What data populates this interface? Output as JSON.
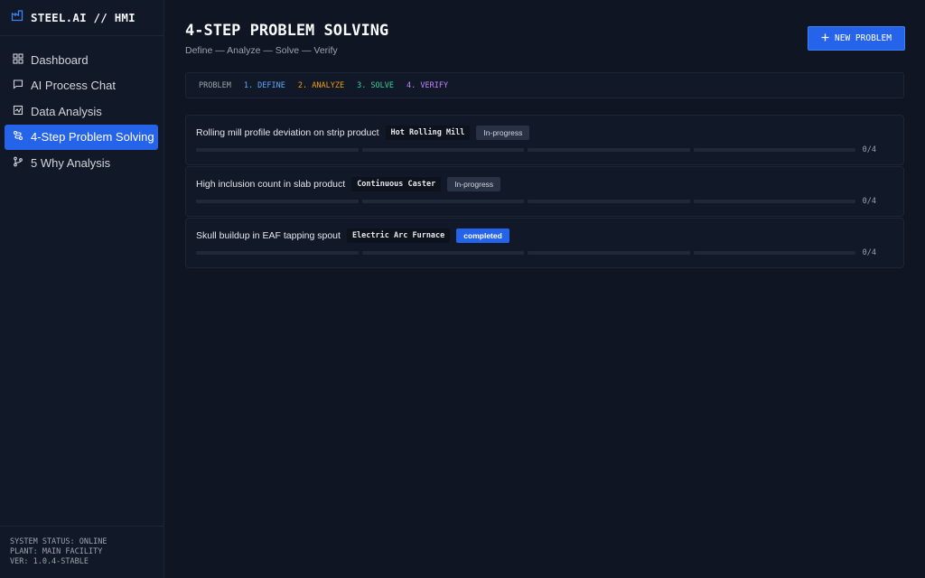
{
  "brand": {
    "title": "STEEL.AI // HMI",
    "icon": "factory-icon"
  },
  "sidebar": {
    "items": [
      {
        "label": "Dashboard",
        "icon": "grid-icon",
        "active": false
      },
      {
        "label": "AI Process Chat",
        "icon": "chat-icon",
        "active": false
      },
      {
        "label": "Data Analysis",
        "icon": "chart-icon",
        "active": false
      },
      {
        "label": "4-Step Problem Solving",
        "icon": "route-icon",
        "active": true
      },
      {
        "label": "5 Why Analysis",
        "icon": "branch-icon",
        "active": false
      }
    ]
  },
  "system": {
    "status": "SYSTEM STATUS: ONLINE",
    "plant": "PLANT: MAIN FACILITY",
    "version": "VER: 1.0.4-STABLE"
  },
  "header": {
    "title": "4-STEP PROBLEM SOLVING",
    "subtitle": "Define — Analyze — Solve — Verify",
    "new_button": "NEW PROBLEM"
  },
  "legend": {
    "label": "PROBLEM",
    "steps": [
      {
        "label": "1. DEFINE",
        "color": "#60a5fa"
      },
      {
        "label": "2. ANALYZE",
        "color": "#f59e0b"
      },
      {
        "label": "3. SOLVE",
        "color": "#34d399"
      },
      {
        "label": "4. VERIFY",
        "color": "#c084fc"
      }
    ]
  },
  "problems": [
    {
      "title": "Rolling mill profile deviation on strip product",
      "area": "Hot Rolling Mill",
      "status": "In-progress",
      "progress": "0/4",
      "steps_done": 0
    },
    {
      "title": "High inclusion count in slab product",
      "area": "Continuous Caster",
      "status": "In-progress",
      "progress": "0/4",
      "steps_done": 0
    },
    {
      "title": "Skull buildup in EAF tapping spout",
      "area": "Electric Arc Furnace",
      "status": "completed",
      "progress": "0/4",
      "steps_done": 0
    }
  ],
  "colors": {
    "accent": "#2563eb",
    "background": "#0f1523",
    "panel": "#111827"
  }
}
